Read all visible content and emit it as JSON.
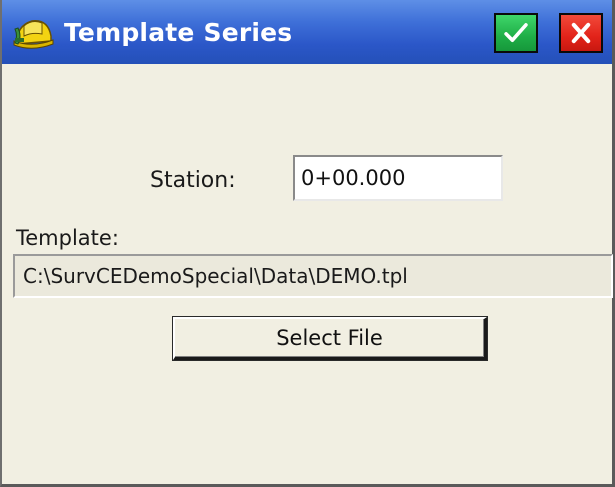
{
  "window": {
    "title": "Template Series",
    "icon": "hardhat-app-icon",
    "ok_icon": "check-icon",
    "close_icon": "close-icon"
  },
  "form": {
    "station_label": "Station:",
    "station_value": "0+00.000",
    "template_label": "Template:",
    "template_path": "C:\\SurvCEDemoSpecial\\Data\\DEMO.tpl",
    "select_file_label": "Select File"
  },
  "colors": {
    "titlebar": "#2b57c8",
    "ok_button": "#1fae47",
    "close_button": "#e2231a",
    "background": "#f1efe2"
  }
}
